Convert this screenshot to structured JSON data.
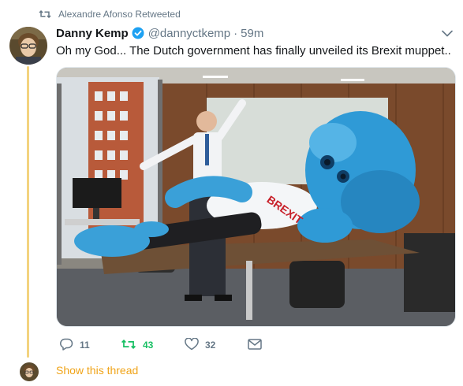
{
  "retweet_context": {
    "text": "Alexandre Afonso Retweeted",
    "icon": "retweet-icon"
  },
  "author": {
    "display_name": "Danny Kemp",
    "handle": "@dannyctkemp",
    "verified": true
  },
  "timestamp": "59m",
  "separator": "·",
  "tweet_text": "Oh my God... The Dutch government has finally unveiled its Brexit muppet...",
  "media": {
    "shirt_text": "BREXIT"
  },
  "actions": {
    "reply_count": "11",
    "retweet_count": "43",
    "like_count": "32"
  },
  "show_thread": "Show this thread",
  "colors": {
    "thread_line": "#f3d37f",
    "retweet_green": "#17bf63",
    "verified_blue": "#1da1f2",
    "show_thread": "#f0a419",
    "muted": "#657786"
  }
}
